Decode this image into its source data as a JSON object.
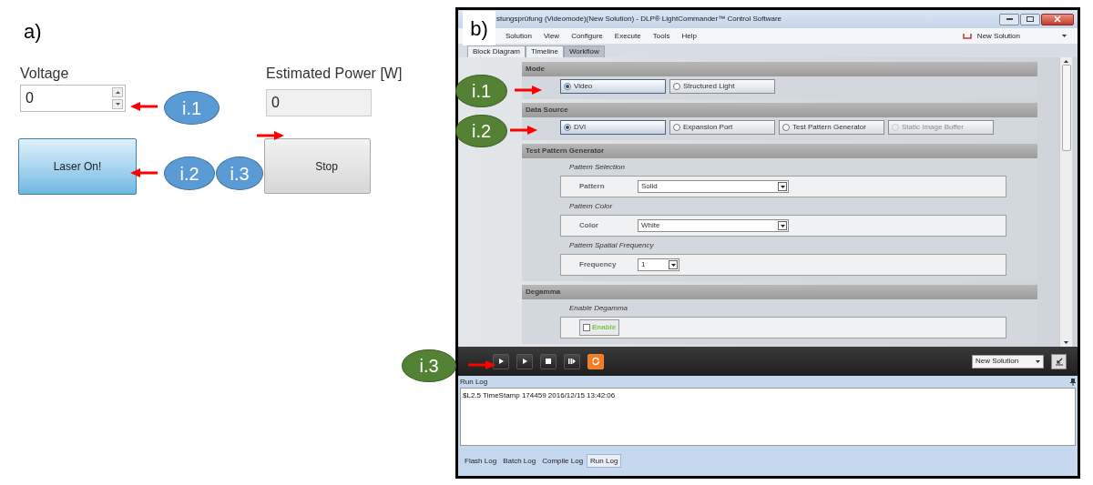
{
  "panel_a": {
    "label": "a)",
    "voltage": {
      "label": "Voltage",
      "value": "0"
    },
    "power": {
      "label": "Estimated Power [W]",
      "value": "0"
    },
    "laser_button": "Laser On!",
    "stop_button": "Stop",
    "callouts": [
      "i.1",
      "i.2",
      "i.3"
    ]
  },
  "panel_b": {
    "label": "b)",
    "window": {
      "title": "stungsprüfung (Videomode)(New Solution) - DLP® LightCommander™ Control Software"
    },
    "menu": [
      "Solution",
      "View",
      "Configure",
      "Execute",
      "Tools",
      "Help"
    ],
    "solution_menu": "New Solution",
    "tabs": [
      {
        "label": "Block Diagram",
        "selected": false
      },
      {
        "label": "Timeline",
        "selected": false
      },
      {
        "label": "Workflow",
        "selected": true
      }
    ],
    "sections": [
      {
        "title": "Mode",
        "kind": "radios",
        "options": [
          {
            "label": "Video",
            "selected": true,
            "disabled": false
          },
          {
            "label": "Structured Light",
            "selected": false,
            "disabled": false
          }
        ]
      },
      {
        "title": "Data Source",
        "kind": "radios",
        "options": [
          {
            "label": "DVI",
            "selected": true,
            "disabled": false
          },
          {
            "label": "Expansion Port",
            "selected": false,
            "disabled": false
          },
          {
            "label": "Test Pattern Generator",
            "selected": false,
            "disabled": false
          },
          {
            "label": "Static Image Buffer",
            "selected": false,
            "disabled": true
          }
        ]
      },
      {
        "title": "Test Pattern Generator",
        "kind": "groups",
        "groups": [
          {
            "title": "Pattern Selection",
            "kind": "select",
            "label": "Pattern",
            "value": "Solid",
            "wide": true
          },
          {
            "title": "Pattern Color",
            "kind": "select",
            "label": "Color",
            "value": "White",
            "wide": true
          },
          {
            "title": "Pattern Spatial Frequency",
            "kind": "select",
            "label": "Frequency",
            "value": "1",
            "wide": false
          }
        ]
      },
      {
        "title": "Degamma",
        "kind": "groups",
        "groups": [
          {
            "title": "Enable Degamma",
            "kind": "checkbox",
            "label": "Enable",
            "checked": false
          }
        ]
      }
    ],
    "toolbar": {
      "solution": "New Solution"
    },
    "run_log": {
      "title": "Run Log",
      "lines": [
        "$L2.5 TimeStamp 174459 2016/12/15 13:42:06"
      ]
    },
    "log_tabs": [
      {
        "label": "Flash Log",
        "selected": false
      },
      {
        "label": "Batch Log",
        "selected": false
      },
      {
        "label": "Compile Log",
        "selected": false
      },
      {
        "label": "Run Log",
        "selected": true
      }
    ],
    "callouts": [
      "i.1",
      "i.2",
      "i.3"
    ]
  }
}
